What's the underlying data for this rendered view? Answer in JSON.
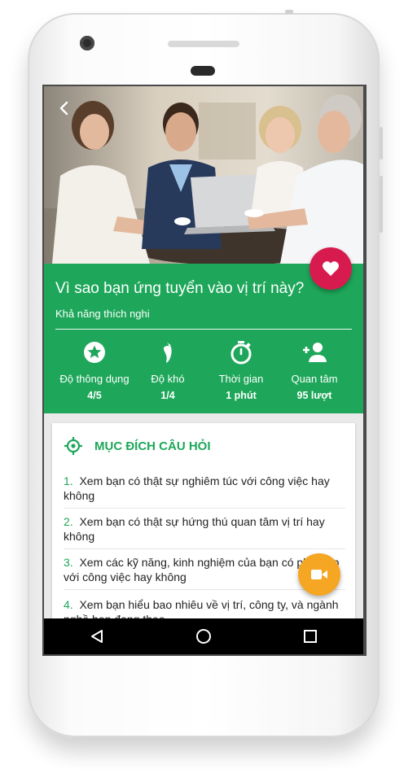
{
  "header": {
    "back_icon": "arrow-back-icon",
    "favorite_icon": "heart-icon",
    "accent_color": "#d81b4e"
  },
  "question": {
    "title": "Vì sao bạn ứng tuyển vào vị trí này?",
    "subtitle": "Khả năng thích nghi",
    "background_color": "#1ea75a"
  },
  "stats": [
    {
      "icon": "star-circle-icon",
      "label": "Độ thông dụng",
      "value": "4/5"
    },
    {
      "icon": "chili-icon",
      "label": "Độ khó",
      "value": "1/4"
    },
    {
      "icon": "stopwatch-icon",
      "label": "Thời gian",
      "value": "1 phút"
    },
    {
      "icon": "add-person-icon",
      "label": "Quan tâm",
      "value": "95 lượt"
    }
  ],
  "purpose": {
    "icon": "crosshair-icon",
    "title": "MỤC ĐÍCH CÂU HỎI",
    "items": [
      {
        "num": "1.",
        "text": "Xem bạn có thật sự nghiêm túc với công việc hay không"
      },
      {
        "num": "2.",
        "text": "Xem bạn có thật sự hứng thú quan tâm vị trí hay không"
      },
      {
        "num": "3.",
        "text": "Xem các kỹ năng, kinh nghiệm của bạn có phù hợp với công việc hay không"
      },
      {
        "num": "4.",
        "text": "Xem bạn hiểu bao nhiêu về vị trí, công ty, và ngành nghề bạn đang theo"
      }
    ]
  },
  "fab": {
    "icon": "video-camera-icon",
    "color": "#f5a623"
  },
  "navbar": {
    "back_icon": "triangle-back-icon",
    "home_icon": "circle-home-icon",
    "recents_icon": "square-recents-icon"
  }
}
